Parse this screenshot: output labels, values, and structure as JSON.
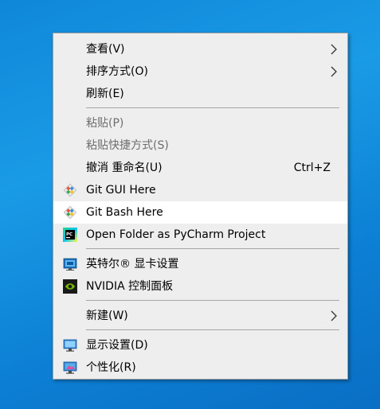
{
  "menu": {
    "items": [
      {
        "label": "查看(V)",
        "has_submenu": true
      },
      {
        "label": "排序方式(O)",
        "has_submenu": true
      },
      {
        "label": "刷新(E)"
      },
      {
        "label": "粘贴(P)",
        "disabled": true
      },
      {
        "label": "粘贴快捷方式(S)",
        "disabled": true
      },
      {
        "label": "撤消 重命名(U)",
        "shortcut": "Ctrl+Z"
      },
      {
        "label": "Git GUI Here",
        "icon": "git-gui-icon"
      },
      {
        "label": "Git Bash Here",
        "icon": "git-bash-icon",
        "highlighted": true
      },
      {
        "label": "Open Folder as PyCharm Project",
        "icon": "pycharm-icon"
      },
      {
        "label": "英特尔® 显卡设置",
        "icon": "intel-graphics-icon"
      },
      {
        "label": "NVIDIA 控制面板",
        "icon": "nvidia-icon"
      },
      {
        "label": "新建(W)",
        "has_submenu": true
      },
      {
        "label": "显示设置(D)",
        "icon": "display-settings-icon"
      },
      {
        "label": "个性化(R)",
        "icon": "personalize-icon"
      }
    ]
  },
  "colors": {
    "desktop": "#1a8fe0",
    "menu_bg": "#eeeeee",
    "highlight": "#ffffff",
    "disabled_text": "#6d6d6d"
  }
}
